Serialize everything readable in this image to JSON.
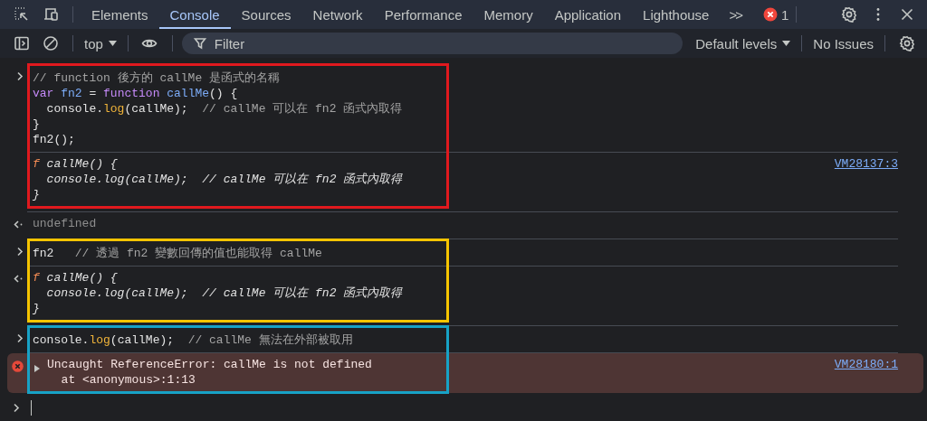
{
  "tabbar": {
    "tabs": [
      {
        "label": "Elements",
        "selected": false
      },
      {
        "label": "Console",
        "selected": true
      },
      {
        "label": "Sources",
        "selected": false
      },
      {
        "label": "Network",
        "selected": false
      },
      {
        "label": "Performance",
        "selected": false
      },
      {
        "label": "Memory",
        "selected": false
      },
      {
        "label": "Application",
        "selected": false
      },
      {
        "label": "Lighthouse",
        "selected": false
      }
    ],
    "overflow": ">>",
    "error_count": "1"
  },
  "toolbar": {
    "context": "top",
    "filter": {
      "placeholder": "Filter"
    },
    "levels": "Default levels",
    "issues": "No Issues"
  },
  "console": {
    "blocks": [
      {
        "color": "#e0191e",
        "entries": [
          {
            "kind": "input",
            "lines": [
              [
                {
                  "kind": "comment",
                  "text": "// function 後方的 callMe 是函式的名稱"
                }
              ],
              [
                {
                  "kind": "keyword",
                  "text": "var "
                },
                {
                  "kind": "name",
                  "text": "fn2"
                },
                {
                  "kind": "plain",
                  "text": " = "
                },
                {
                  "kind": "keyword",
                  "text": "function "
                },
                {
                  "kind": "name",
                  "text": "callMe"
                },
                {
                  "kind": "plain",
                  "text": "() {"
                }
              ],
              [
                {
                  "kind": "plain",
                  "text": "  console."
                },
                {
                  "kind": "method",
                  "text": "log"
                },
                {
                  "kind": "plain",
                  "text": "(callMe);  "
                },
                {
                  "kind": "comment",
                  "text": "// callMe 可以在 fn2 函式內取得"
                }
              ],
              [
                {
                  "kind": "plain",
                  "text": "}"
                }
              ],
              [
                {
                  "kind": "plain",
                  "text": "fn2();"
                }
              ]
            ]
          },
          {
            "kind": "log",
            "source": "VM28137:3",
            "lines": [
              [
                {
                  "kind": "fn-mark",
                  "text": "f"
                },
                {
                  "kind": "plain",
                  "text": " callMe() {"
                }
              ],
              [
                {
                  "kind": "plain",
                  "text": "  console.log(callMe);  // callMe 可以在 fn2 函式內取得"
                }
              ],
              [
                {
                  "kind": "plain",
                  "text": "}"
                }
              ]
            ]
          }
        ]
      },
      {
        "entries": [
          {
            "kind": "result",
            "lines": [
              [
                {
                  "kind": "undefined",
                  "text": "undefined"
                }
              ]
            ]
          }
        ]
      },
      {
        "color": "#f5c400",
        "entries": [
          {
            "kind": "input",
            "lines": [
              [
                {
                  "kind": "plain",
                  "text": "fn2   "
                },
                {
                  "kind": "comment",
                  "text": "// 透過 fn2 變數回傳的值也能取得 callMe"
                }
              ]
            ]
          },
          {
            "kind": "result",
            "lines": [
              [
                {
                  "kind": "fn-mark",
                  "text": "f"
                },
                {
                  "kind": "plain",
                  "text": " callMe() {"
                }
              ],
              [
                {
                  "kind": "plain",
                  "text": "  console.log(callMe);  // callMe 可以在 fn2 函式內取得"
                }
              ],
              [
                {
                  "kind": "plain",
                  "text": "}"
                }
              ]
            ]
          }
        ]
      },
      {
        "color": "#17a2c6",
        "entries": [
          {
            "kind": "input",
            "lines": [
              [
                {
                  "kind": "plain",
                  "text": "console."
                },
                {
                  "kind": "method",
                  "text": "log"
                },
                {
                  "kind": "plain",
                  "text": "(callMe);  "
                },
                {
                  "kind": "comment",
                  "text": "// callMe 無法在外部被取用"
                }
              ]
            ]
          },
          {
            "kind": "error",
            "expanded": false,
            "source": "VM28180:1",
            "lines": [
              [
                {
                  "kind": "error",
                  "text": "Uncaught ReferenceError: callMe is not defined"
                }
              ],
              [
                {
                  "kind": "error",
                  "text": "  at <anonymous>:1:13"
                }
              ]
            ]
          }
        ]
      }
    ]
  }
}
